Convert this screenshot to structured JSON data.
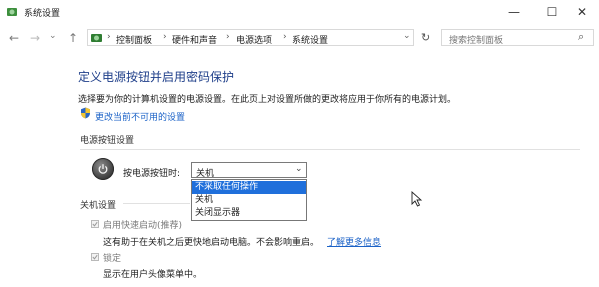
{
  "window": {
    "title": "系统设置",
    "minimize_glyph": "—",
    "maximize_glyph": "☐",
    "close_glyph": "✕"
  },
  "nav": {
    "back_glyph": "←",
    "forward_glyph": "→",
    "history_glyph": "⌄",
    "up_glyph": "↑",
    "refresh_glyph": "↻",
    "dropdown_glyph": "⌄",
    "breadcrumbs": [
      "控制面板",
      "硬件和声音",
      "电源选项",
      "系统设置"
    ],
    "separator": "›",
    "search_placeholder": "搜索控制面板",
    "search_glyph": "⌕"
  },
  "main": {
    "title": "定义电源按钮并启用密码保护",
    "description": "选择要为你的计算机设置的电源设置。在此页上对设置所做的更改将应用于你所有的电源计划。",
    "change_link": "更改当前不可用的设置",
    "power_section": {
      "label": "电源按钮设置",
      "power_button_label": "按电源按钮时:",
      "selected": "关机",
      "options": [
        "不采取任何操作",
        "关机",
        "关闭显示器"
      ],
      "highlighted_index": 0
    },
    "shutdown_section": {
      "label": "关机设置",
      "fast_startup_label": "启用快速启动(推荐)",
      "fast_startup_desc": "这有助于在关机之后更快地启动电脑。不会影响重启。",
      "learn_more": "了解更多信息",
      "lock_label": "锁定",
      "lock_desc": "显示在用户头像菜单中。"
    }
  },
  "colors": {
    "accent": "#1f6fdb",
    "title_blue": "#1f3f8a",
    "link": "#1b62c7"
  }
}
